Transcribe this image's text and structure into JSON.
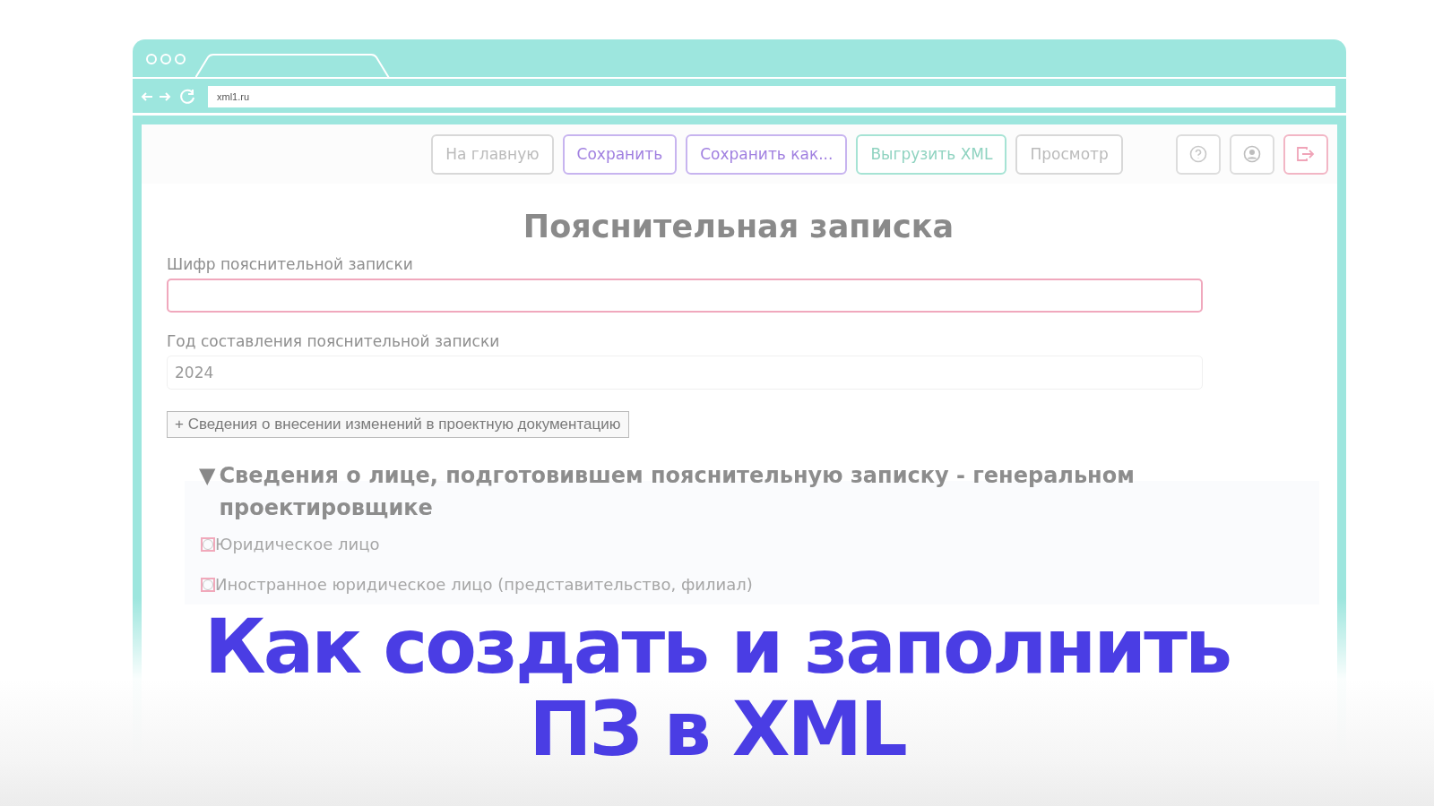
{
  "browser": {
    "url": "xml1.ru"
  },
  "toolbar": {
    "buttons": [
      {
        "label": "На главную",
        "kind": "plain"
      },
      {
        "label": "Сохранить",
        "kind": "primary"
      },
      {
        "label": "Сохранить как...",
        "kind": "primary"
      },
      {
        "label": "Выгрузить XML",
        "kind": "export"
      },
      {
        "label": "Просмотр",
        "kind": "plain"
      }
    ],
    "icons": [
      {
        "kind": "help"
      },
      {
        "kind": "account"
      },
      {
        "kind": "logout"
      }
    ]
  },
  "form": {
    "title": "Пояснительная записка",
    "fields": [
      {
        "label": "Шифр пояснительной записки",
        "required": true
      },
      {
        "label": "Год составления пояснительной записки",
        "value": "2024",
        "required": false
      }
    ],
    "add_button": "+ Сведения о внесении изменений в проектную документацию",
    "section": {
      "title": "Сведения о лице, подготовившем пояснительную записку - генеральном проектировщике",
      "marker": "▼",
      "expanded": true,
      "options": [
        {
          "label": "Юридическое лицо",
          "checked": false
        },
        {
          "label": "Иностранное юридическое лицо (представительство, филиал)",
          "checked": false
        }
      ]
    }
  },
  "headline": [
    "Как создать и заполнить",
    "ПЗ в XML"
  ]
}
